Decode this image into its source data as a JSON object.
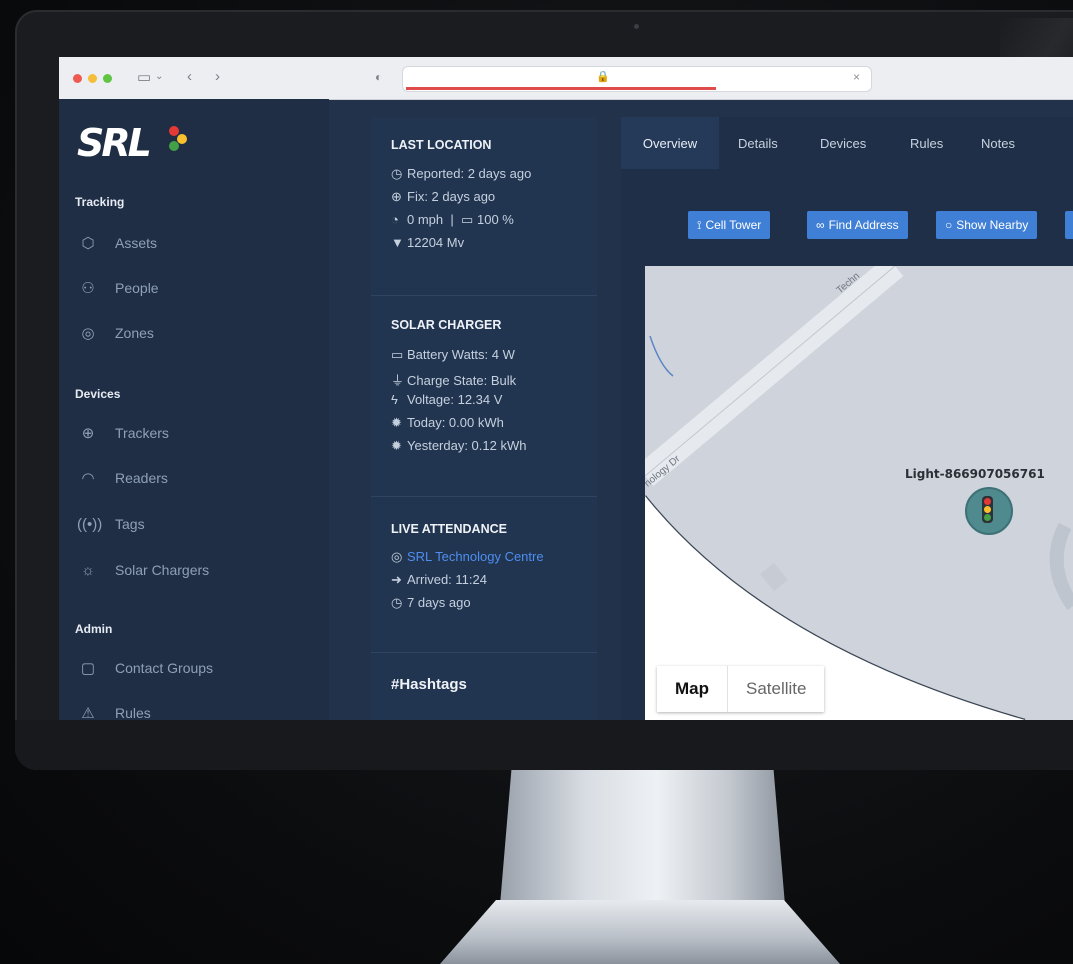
{
  "browser": {
    "url_placeholder": "",
    "close_glyph": "×",
    "lock_glyph": "🔒"
  },
  "sidebar": {
    "logo": "SRL",
    "sections": [
      {
        "title": "Tracking",
        "items": [
          {
            "label": "Assets",
            "icon": "box-icon"
          },
          {
            "label": "People",
            "icon": "people-icon"
          },
          {
            "label": "Zones",
            "icon": "target-icon"
          }
        ]
      },
      {
        "title": "Devices",
        "items": [
          {
            "label": "Trackers",
            "icon": "globe-icon"
          },
          {
            "label": "Readers",
            "icon": "wifi-icon"
          },
          {
            "label": "Tags",
            "icon": "broadcast-icon"
          },
          {
            "label": "Solar Chargers",
            "icon": "sun-icon"
          }
        ]
      },
      {
        "title": "Admin",
        "items": [
          {
            "label": "Contact Groups",
            "icon": "clipboard-icon"
          },
          {
            "label": "Rules",
            "icon": "warning-icon"
          }
        ]
      }
    ]
  },
  "last_location": {
    "title": "LAST LOCATION",
    "reported": "Reported: 2 days ago",
    "fix": "Fix: 2 days ago",
    "speed": "0 mph",
    "separator": "|",
    "battery": "100 %",
    "voltage": "12204 Mv"
  },
  "solar_charger": {
    "title": "SOLAR CHARGER",
    "battery_watts": "Battery Watts: 4 W",
    "charge_state": "Charge State: Bulk",
    "voltage": "Voltage: 12.34 V",
    "today": "Today: 0.00 kWh",
    "yesterday": "Yesterday: 0.12 kWh"
  },
  "live_attendance": {
    "title": "LIVE ATTENDANCE",
    "location": "SRL Technology Centre",
    "arrived": "Arrived: 11:24",
    "ago": "7 days ago"
  },
  "hashtags": {
    "title": "#Hashtags"
  },
  "tabs": [
    "Overview",
    "Details",
    "Devices",
    "Rules",
    "Notes"
  ],
  "actions": {
    "cell_tower": "Cell Tower",
    "find_address": "Find Address",
    "show_nearby": "Show Nearby"
  },
  "map": {
    "marker_label": "Light-866907056761",
    "road_label_1": "Techn",
    "road_label_2": "nology Dr",
    "view_map": "Map",
    "view_satellite": "Satellite"
  },
  "colors": {
    "accent": "#3f7fd6",
    "sidebar_bg": "#1f2e45",
    "panel_bg": "#223550",
    "link": "#4d8ef0",
    "voltage_green": "#4fd16a"
  }
}
